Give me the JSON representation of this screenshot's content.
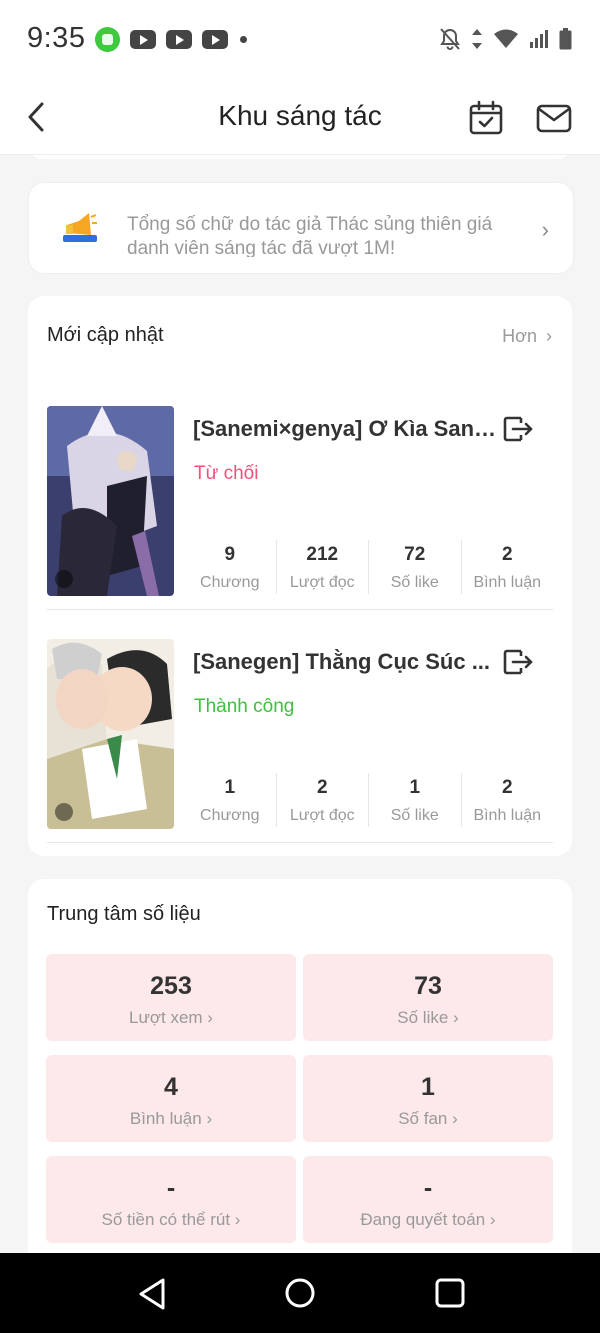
{
  "status_bar": {
    "time": "9:35",
    "left_icons": [
      "wechat-icon",
      "youtube-icon",
      "youtube-icon",
      "youtube-icon",
      "dot-icon"
    ],
    "right_icons": [
      "bell-off-icon",
      "data-arrows-icon",
      "wifi-icon",
      "signal-icon",
      "battery-icon"
    ]
  },
  "header": {
    "title": "Khu sáng tác",
    "icons": [
      "back-arrow-icon",
      "calendar-check-icon",
      "mail-icon"
    ]
  },
  "notice": {
    "text": "Tổng số chữ do tác giả Thác sủng thiên giá danh viên sáng tác đã vượt 1M!",
    "icon": "megaphone-icon"
  },
  "updates": {
    "title": "Mới cập nhật",
    "more_label": "Hơn",
    "works": [
      {
        "title": "[Sanemi×genya] Ơ Kìa Sane...",
        "status": "Từ chối",
        "status_color": "#f2527a",
        "stats": [
          {
            "value": "9",
            "label": "Chương"
          },
          {
            "value": "212",
            "label": "Lượt đọc"
          },
          {
            "value": "72",
            "label": "Số like"
          },
          {
            "value": "2",
            "label": "Bình luận"
          }
        ]
      },
      {
        "title": "[Sanegen] Thằng Cục Súc ...",
        "status": "Thành công",
        "status_color": "#3cc23c",
        "stats": [
          {
            "value": "1",
            "label": "Chương"
          },
          {
            "value": "2",
            "label": "Lượt đọc"
          },
          {
            "value": "1",
            "label": "Số like"
          },
          {
            "value": "2",
            "label": "Bình luận"
          }
        ]
      }
    ]
  },
  "data_center": {
    "title": "Trung tâm số liệu",
    "tiles": [
      {
        "value": "253",
        "label": "Lượt xem"
      },
      {
        "value": "73",
        "label": "Số like"
      },
      {
        "value": "4",
        "label": "Bình luận"
      },
      {
        "value": "1",
        "label": "Số fan"
      },
      {
        "value": "-",
        "label": "Số tiền có thể rút"
      },
      {
        "value": "-",
        "label": "Đang quyết toán"
      }
    ]
  },
  "nav_bar": {
    "icons": [
      "nav-back-icon",
      "nav-home-icon",
      "nav-recents-icon"
    ]
  }
}
